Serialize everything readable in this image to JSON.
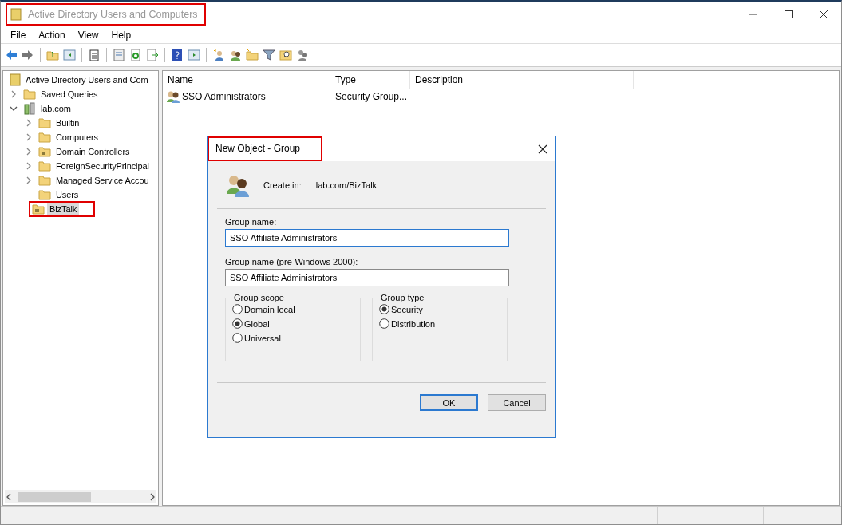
{
  "window": {
    "title": "Active Directory Users and Computers",
    "highlighted": true
  },
  "menu": [
    "File",
    "Action",
    "View",
    "Help"
  ],
  "tree": [
    {
      "label": "Active Directory Users and Com",
      "kind": "console",
      "selected": false,
      "highlighted": false,
      "children": [
        {
          "label": "Saved Queries",
          "kind": "folder",
          "expandable": true,
          "expanded": false,
          "selected": false,
          "highlighted": false
        },
        {
          "label": "lab.com",
          "kind": "domain",
          "expandable": true,
          "expanded": true,
          "selected": false,
          "highlighted": false,
          "children": [
            {
              "label": "Builtin",
              "kind": "folder",
              "expandable": true,
              "expanded": false,
              "selected": false,
              "highlighted": false
            },
            {
              "label": "Computers",
              "kind": "folder",
              "expandable": true,
              "expanded": false,
              "selected": false,
              "highlighted": false
            },
            {
              "label": "Domain Controllers",
              "kind": "ou",
              "expandable": true,
              "expanded": false,
              "selected": false,
              "highlighted": false
            },
            {
              "label": "ForeignSecurityPrincipal",
              "kind": "folder",
              "expandable": true,
              "expanded": false,
              "selected": false,
              "highlighted": false
            },
            {
              "label": "Managed Service Accou",
              "kind": "folder",
              "expandable": true,
              "expanded": false,
              "selected": false,
              "highlighted": false
            },
            {
              "label": "Users",
              "kind": "folder",
              "expandable": false,
              "selected": false,
              "highlighted": false
            },
            {
              "label": "BizTalk",
              "kind": "ou",
              "expandable": false,
              "selected": true,
              "highlighted": true
            }
          ]
        }
      ]
    }
  ],
  "list": {
    "columns": [
      "Name",
      "Type",
      "Description"
    ],
    "rows": [
      {
        "name": "SSO Administrators",
        "type": "Security Group..."
      }
    ]
  },
  "dialog": {
    "title": "New Object - Group",
    "highlighted": true,
    "create_in_label": "Create in:",
    "create_in_value": "lab.com/BizTalk",
    "fields": [
      {
        "label": "Group name:",
        "value": "SSO Affiliate Administrators",
        "focused": true
      },
      {
        "label": "Group name (pre-Windows 2000):",
        "value": "SSO Affiliate Administrators",
        "focused": false
      }
    ],
    "groups": [
      {
        "title": "Group scope",
        "options": [
          {
            "label": "Domain local",
            "selected": false
          },
          {
            "label": "Global",
            "selected": true
          },
          {
            "label": "Universal",
            "selected": false
          }
        ]
      },
      {
        "title": "Group type",
        "options": [
          {
            "label": "Security",
            "selected": true
          },
          {
            "label": "Distribution",
            "selected": false
          }
        ]
      }
    ],
    "buttons": [
      {
        "label": "OK",
        "default": true
      },
      {
        "label": "Cancel",
        "default": false
      }
    ]
  }
}
